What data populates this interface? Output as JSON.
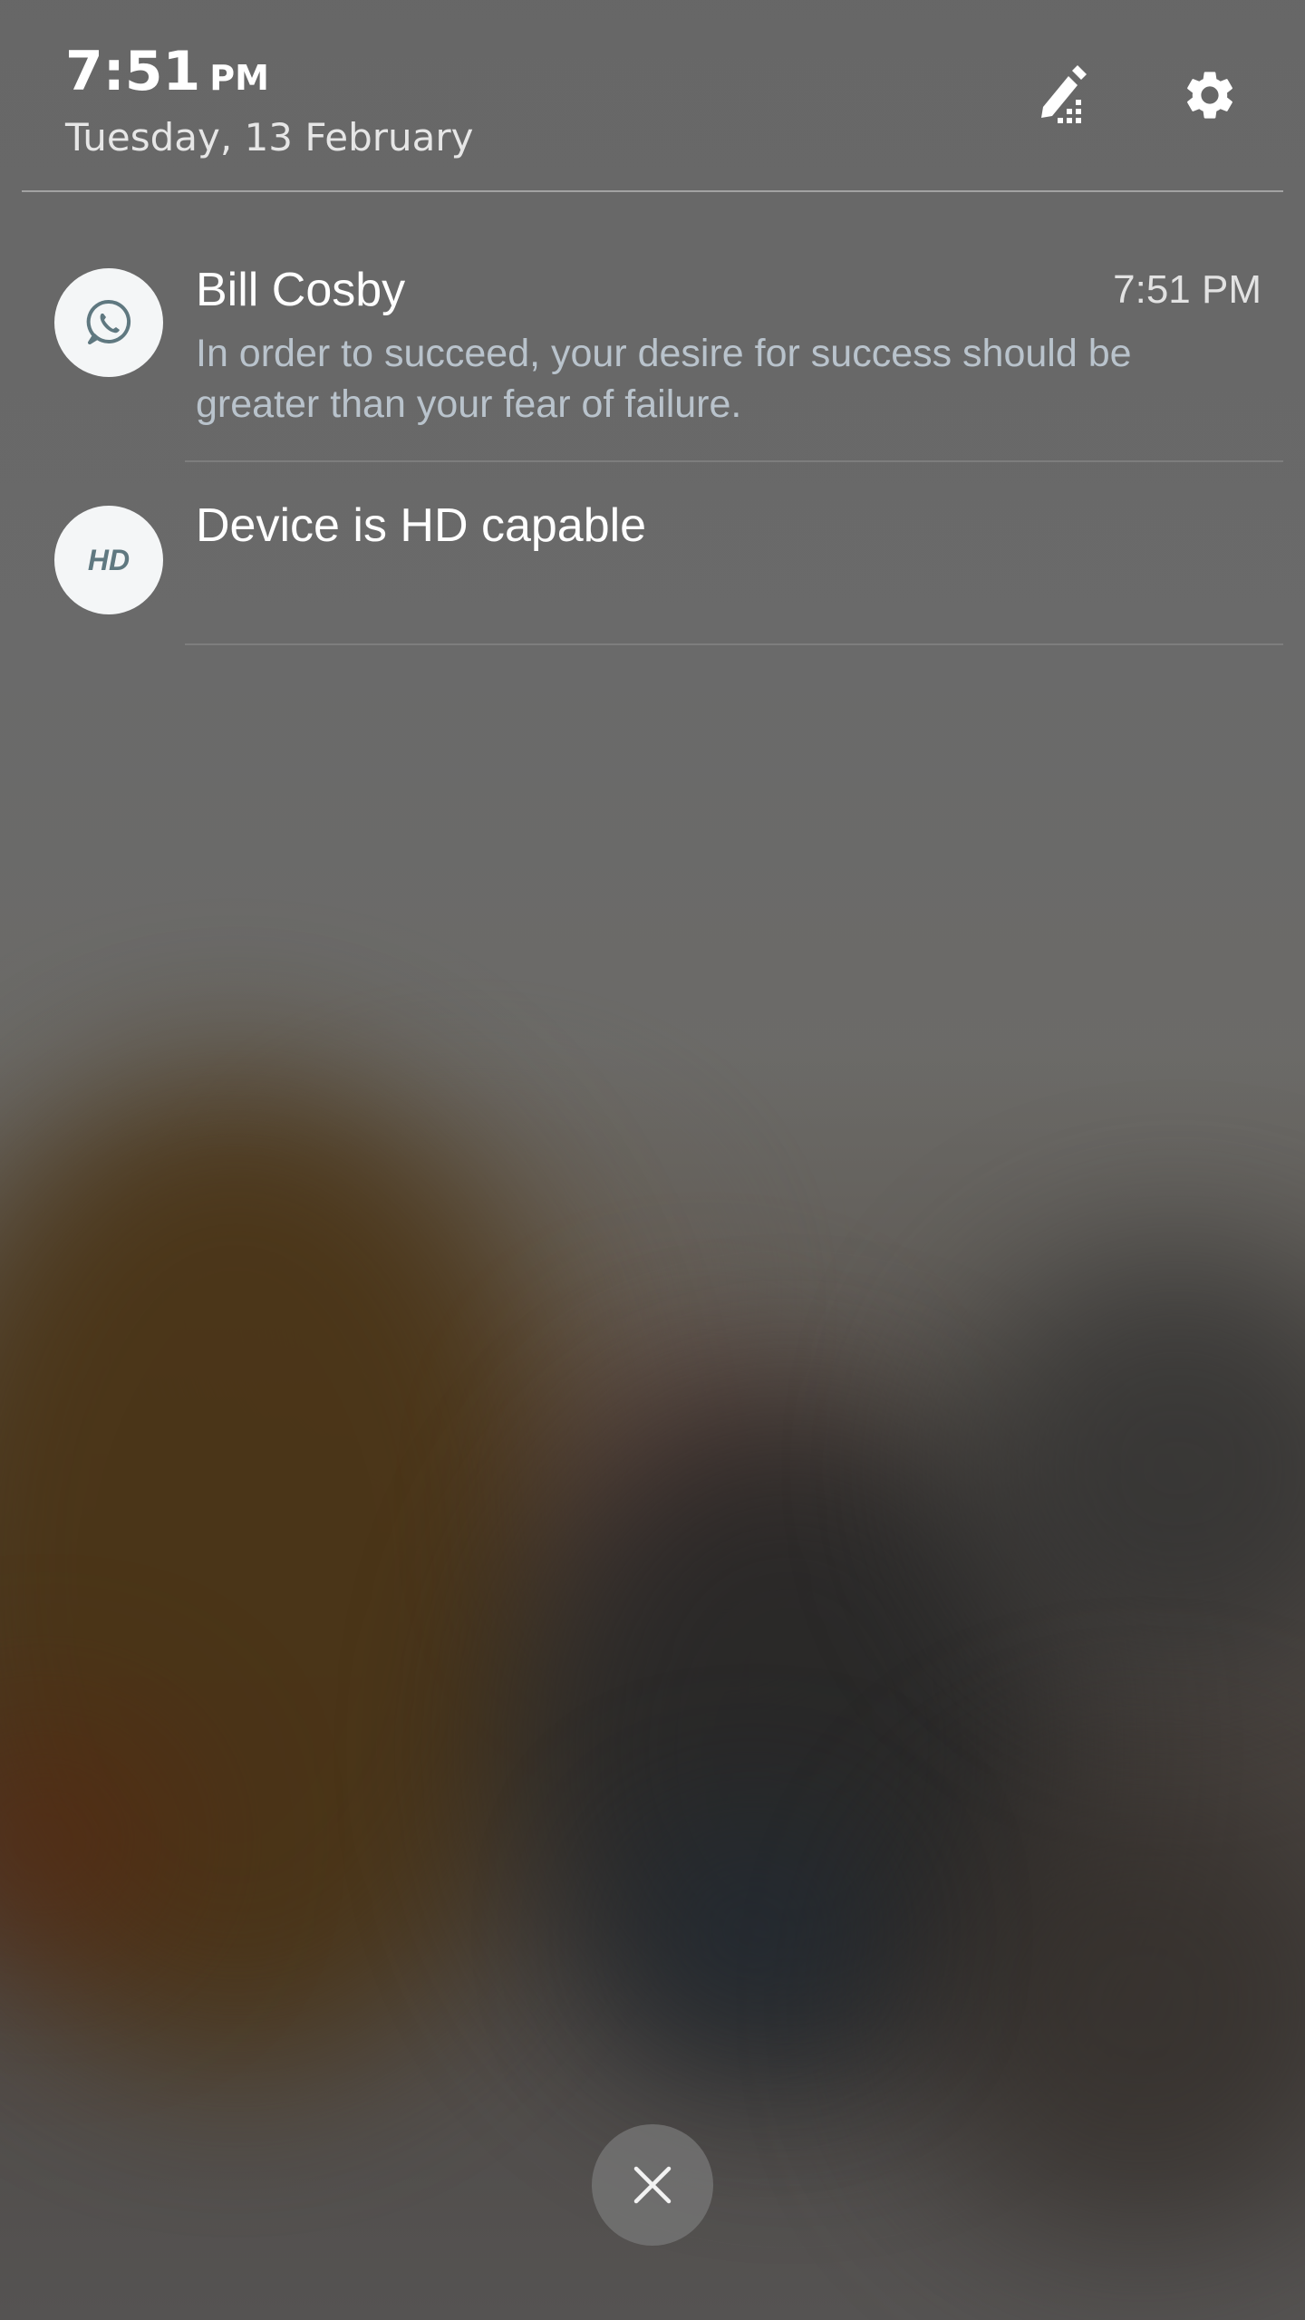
{
  "status": {
    "time": "7:51",
    "ampm": "PM",
    "date": "Tuesday, 13 February"
  },
  "header": {
    "edit_icon": "edit-pencil-icon",
    "settings_icon": "gear-icon"
  },
  "notifications": [
    {
      "app_icon": "whatsapp-icon",
      "title": "Bill Cosby",
      "time": "7:51 PM",
      "body": "In order to succeed, your desire for success should be greater than your fear of failure."
    },
    {
      "app_icon": "hd-icon",
      "icon_text": "HD",
      "title": "Device is HD capable"
    }
  ],
  "close_icon": "close-x-icon",
  "colors": {
    "whatsapp_icon": "#5f7880",
    "body_text": "#b9c3cc"
  }
}
